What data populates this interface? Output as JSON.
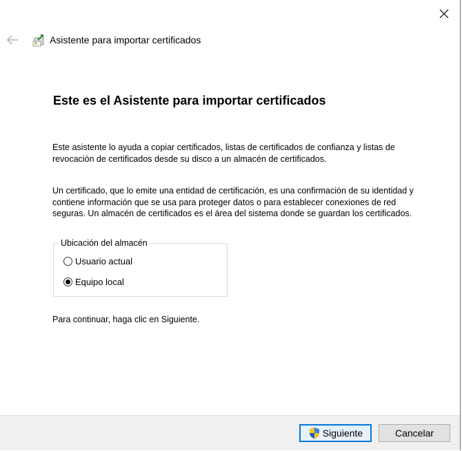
{
  "window": {
    "title": "Asistente para importar certificados",
    "close_icon": "close-icon",
    "back_icon": "back-arrow-icon",
    "wizard_icon": "certificate-import-icon"
  },
  "content": {
    "heading": "Este es el Asistente para importar certificados",
    "paragraph1": "Este asistente lo ayuda a copiar certificados, listas de certificados de confianza y listas de revocación de certificados desde su disco a un almacén de certificados.",
    "paragraph2": "Un certificado, que lo emite una entidad de certificación, es una confirmación de su identidad y contiene información que se usa para proteger datos o para establecer conexiones de red seguras. Un almacén de certificados es el área del sistema donde se guardan los certificados.",
    "store_location": {
      "legend": "Ubicación del almacén",
      "options": [
        {
          "label": "Usuario actual",
          "selected": false
        },
        {
          "label": "Equipo local",
          "selected": true
        }
      ]
    },
    "continue_text": "Para continuar, haga clic en Siguiente."
  },
  "footer": {
    "next_label": "Siguiente",
    "next_icon": "uac-shield-icon",
    "cancel_label": "Cancelar"
  },
  "colors": {
    "accent": "#0078d7",
    "footer_bg": "#f0f0f0",
    "button_bg": "#e1e1e1"
  }
}
